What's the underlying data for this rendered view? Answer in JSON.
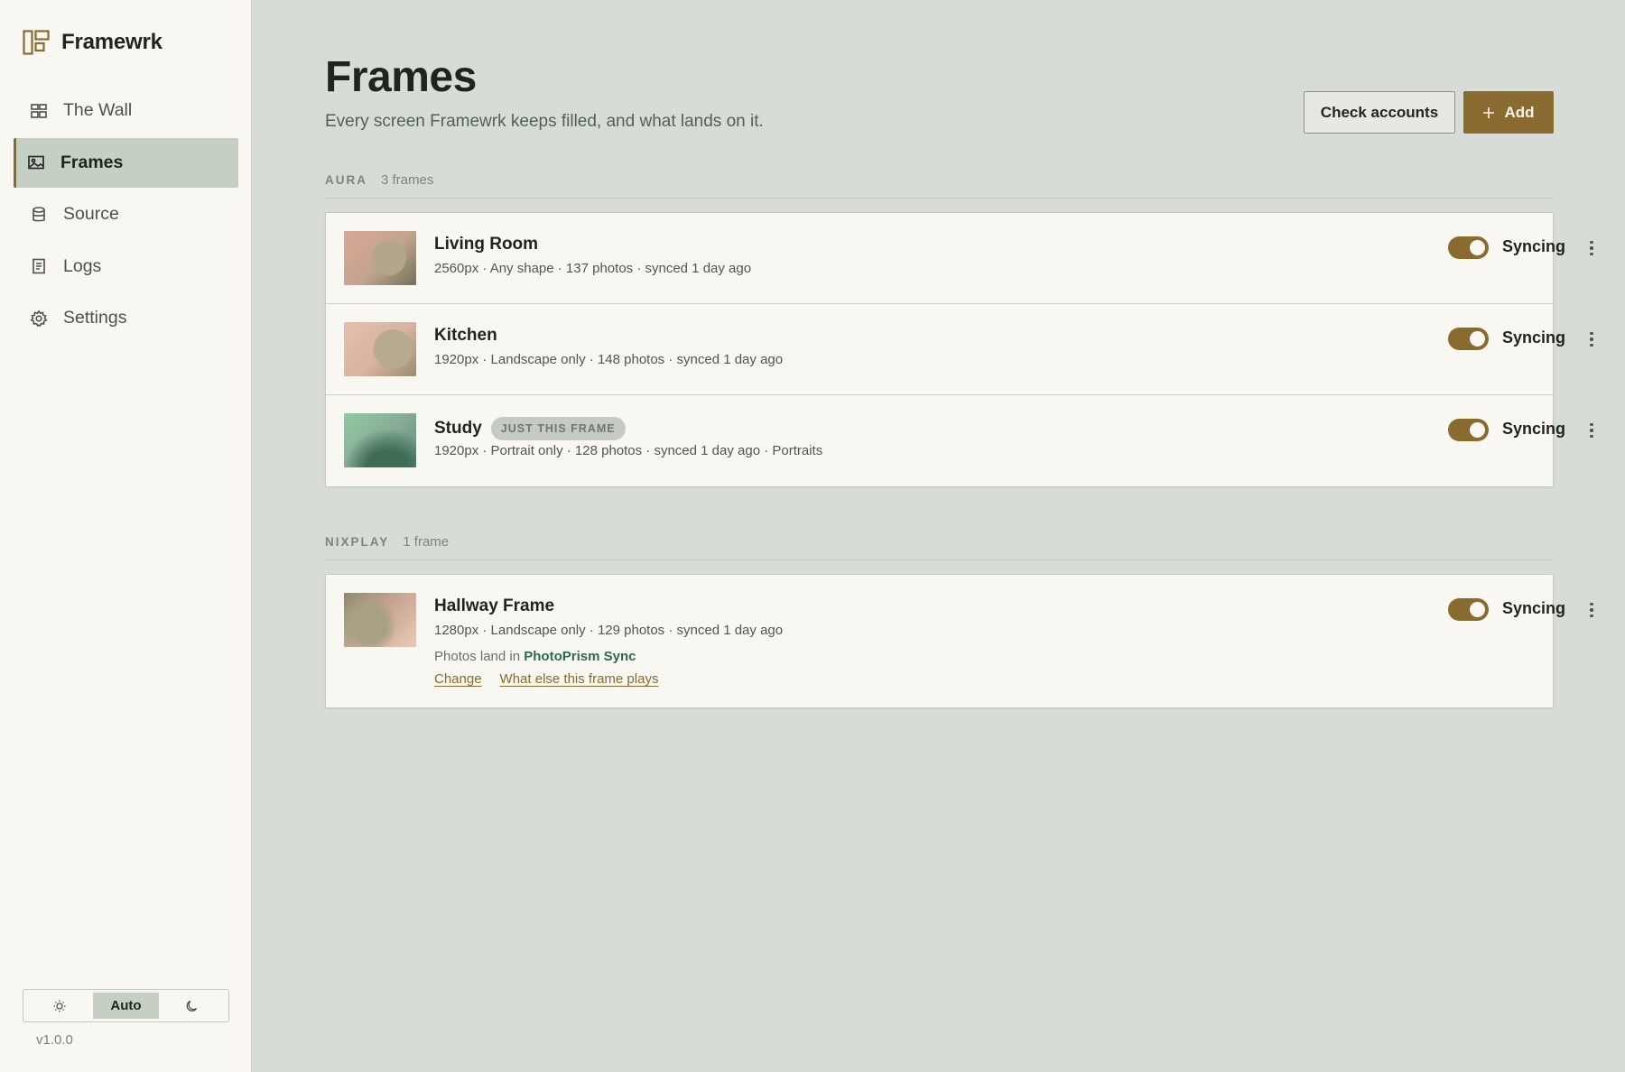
{
  "brand": {
    "name": "Framewrk"
  },
  "nav": [
    {
      "label": "The Wall",
      "icon": "grid-icon",
      "active": false
    },
    {
      "label": "Frames",
      "icon": "image-icon",
      "active": true
    },
    {
      "label": "Source",
      "icon": "database-icon",
      "active": false
    },
    {
      "label": "Logs",
      "icon": "document-icon",
      "active": false
    },
    {
      "label": "Settings",
      "icon": "gear-icon",
      "active": false
    }
  ],
  "theme": {
    "options": [
      "sun-icon",
      "Auto",
      "moon-icon"
    ],
    "selected": "Auto"
  },
  "version": "v1.0.0",
  "page": {
    "title": "Frames",
    "subtitle": "Every screen Framewrk keeps filled, and what lands on it."
  },
  "toolbar": {
    "check_label": "Check accounts",
    "add_label": "Add"
  },
  "groups": [
    {
      "name": "AURA",
      "count": "3 frames",
      "frames": [
        {
          "name": "Living Room",
          "meta": "2560px · Any shape · 137 photos · synced 1 day ago",
          "status": "Syncing",
          "enabled": true
        },
        {
          "name": "Kitchen",
          "meta": "1920px · Landscape only · 148 photos · synced 1 day ago",
          "status": "Syncing",
          "enabled": true
        },
        {
          "name": "Study",
          "badge": "JUST THIS FRAME",
          "meta": "1920px · Portrait only · 128 photos · synced 1 day ago · Portraits",
          "status": "Syncing",
          "enabled": true
        }
      ]
    },
    {
      "name": "NIXPLAY",
      "count": "1 frame",
      "frames": [
        {
          "name": "Hallway Frame",
          "meta": "1280px · Landscape only · 129 photos · synced 1 day ago",
          "status": "Syncing",
          "enabled": true,
          "lands_prefix": "Photos land in",
          "lands_target": "PhotoPrism Sync",
          "action_change": "Change",
          "action_what_else": "What else this frame plays"
        }
      ]
    }
  ],
  "colors": {
    "accent": "#8a6b2f",
    "background": "#d7ddd6",
    "surface": "#f8f7f2",
    "active_nav": "#c5cfc3"
  }
}
